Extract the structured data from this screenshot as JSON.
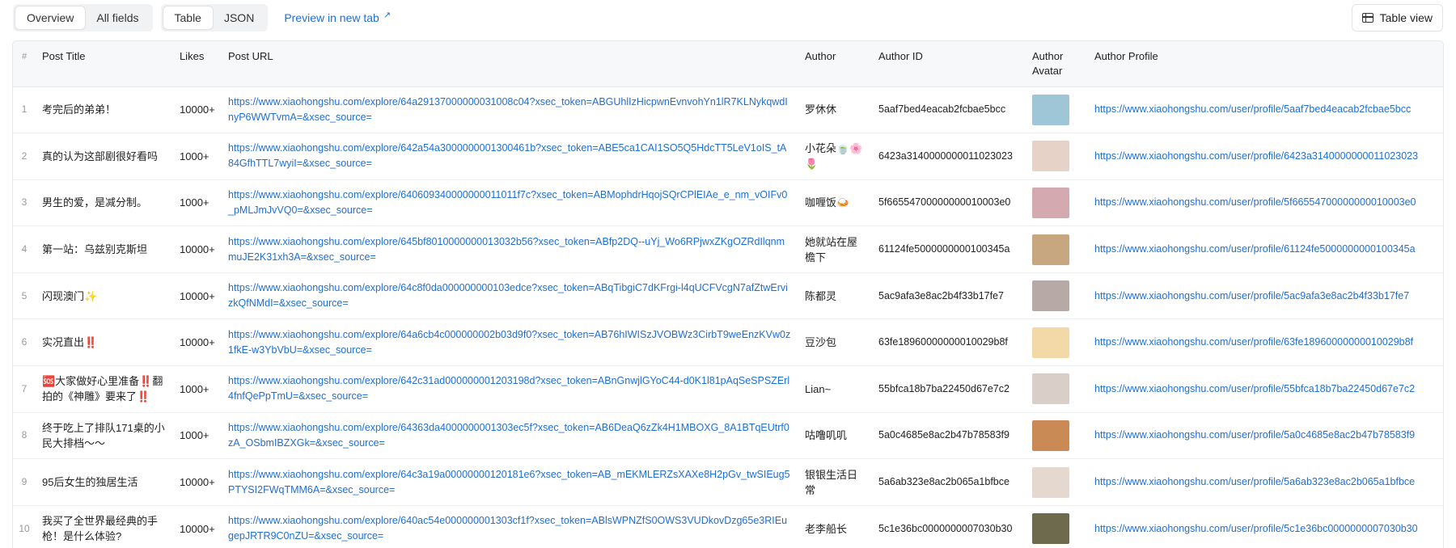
{
  "toolbar": {
    "view_tabs": [
      "Overview",
      "All fields"
    ],
    "format_tabs": [
      "Table",
      "JSON"
    ],
    "preview_link": "Preview in new tab",
    "table_view_button": "Table view"
  },
  "table": {
    "columns": [
      "#",
      "Post Title",
      "Likes",
      "Post URL",
      "Author",
      "Author ID",
      "Author Avatar",
      "Author Profile"
    ],
    "rows": [
      {
        "num": "1",
        "title": "考完后的弟弟！",
        "likes": "10000+",
        "url": "https://www.xiaohongshu.com/explore/64a29137000000031008c04?xsec_token=ABGUhlIzHicpwnEvnvohYn1lR7KLNykqwdInyP6WWTvmA=&xsec_source=",
        "author": "罗休休",
        "author_id": "5aaf7bed4eacab2fcbae5bcc",
        "avatar_color": "#9fc6d6",
        "profile": "https://www.xiaohongshu.com/user/profile/5aaf7bed4eacab2fcbae5bcc"
      },
      {
        "num": "2",
        "title": "真的认为这部剧很好看吗",
        "likes": "1000+",
        "url": "https://www.xiaohongshu.com/explore/642a54a3000000001300461b?xsec_token=ABE5ca1CAI1SO5Q5HdcTT5LeV1oIS_tA84GfhTTL7wyiI=&xsec_source=",
        "author": "小花朵🍵🌸🌷",
        "author_id": "6423a3140000000011023023",
        "avatar_color": "#e6d2c6",
        "profile": "https://www.xiaohongshu.com/user/profile/6423a3140000000011023023"
      },
      {
        "num": "3",
        "title": "男生的爱，是减分制。",
        "likes": "1000+",
        "url": "https://www.xiaohongshu.com/explore/640609340000000011011f7c?xsec_token=ABMophdrHqojSQrCPlEIAe_e_nm_vOIFv0_pMLJmJvVQ0=&xsec_source=",
        "author": "咖喱饭🍛",
        "author_id": "5f66554700000000010003e0",
        "avatar_color": "#d4a9b0",
        "profile": "https://www.xiaohongshu.com/user/profile/5f66554700000000010003e0"
      },
      {
        "num": "4",
        "title": "第一站：乌兹别克斯坦",
        "likes": "10000+",
        "url": "https://www.xiaohongshu.com/explore/645bf8010000000013032b56?xsec_token=ABfp2DQ--uYj_Wo6RPjwxZKgOZRdIlqnmmuJE2K31xh3A=&xsec_source=",
        "author": "她就站在屋檐下",
        "author_id": "61124fe5000000000100345a",
        "avatar_color": "#c6a77f",
        "profile": "https://www.xiaohongshu.com/user/profile/61124fe5000000000100345a"
      },
      {
        "num": "5",
        "title": "闪现澳门✨",
        "likes": "10000+",
        "url": "https://www.xiaohongshu.com/explore/64c8f0da000000000103edce?xsec_token=ABqTibgiC7dKFrgi-l4qUCFVcgN7afZtwErvizkQfNMdI=&xsec_source=",
        "author": "陈都灵",
        "author_id": "5ac9afa3e8ac2b4f33b17fe7",
        "avatar_color": "#b7a9a6",
        "profile": "https://www.xiaohongshu.com/user/profile/5ac9afa3e8ac2b4f33b17fe7"
      },
      {
        "num": "6",
        "title": "实况直出‼️",
        "likes": "10000+",
        "url": "https://www.xiaohongshu.com/explore/64a6cb4c000000002b03d9f0?xsec_token=AB76hIWISzJVOBWz3CirbT9weEnzKVw0z1fkE-w3YbVbU=&xsec_source=",
        "author": "豆沙包",
        "author_id": "63fe18960000000010029b8f",
        "avatar_color": "#f3d9a8",
        "profile": "https://www.xiaohongshu.com/user/profile/63fe18960000000010029b8f"
      },
      {
        "num": "7",
        "title": "🆘大家做好心里准备‼️翻拍的《神雕》要来了‼️",
        "likes": "1000+",
        "url": "https://www.xiaohongshu.com/explore/642c31ad000000001203198d?xsec_token=ABnGnwjlGYoC44-d0K1l81pAqSeSPSZErl4fnfQePpTmU=&xsec_source=",
        "author": "Lian~",
        "author_id": "55bfca18b7ba22450d67e7c2",
        "avatar_color": "#d9cfc8",
        "profile": "https://www.xiaohongshu.com/user/profile/55bfca18b7ba22450d67e7c2"
      },
      {
        "num": "8",
        "title": "终于吃上了排队171桌的小民大排档～～",
        "likes": "1000+",
        "url": "https://www.xiaohongshu.com/explore/64363da4000000001303ec5f?xsec_token=AB6DeaQ6zZk4H1MBOXG_8A1BTqEUtrf0zA_OSbmIBZXGk=&xsec_source=",
        "author": "咕噜叽叽",
        "author_id": "5a0c4685e8ac2b47b78583f9",
        "avatar_color": "#c98a55",
        "profile": "https://www.xiaohongshu.com/user/profile/5a0c4685e8ac2b47b78583f9"
      },
      {
        "num": "9",
        "title": "95后女生的独居生活",
        "likes": "10000+",
        "url": "https://www.xiaohongshu.com/explore/64c3a19a00000000120181e6?xsec_token=AB_mEKMLERZsXAXe8H2pGv_twSIEug5PTYSI2FWqTMM6A=&xsec_source=",
        "author": "银银生活日常",
        "author_id": "5a6ab323e8ac2b065a1bfbce",
        "avatar_color": "#e4d8cf",
        "profile": "https://www.xiaohongshu.com/user/profile/5a6ab323e8ac2b065a1bfbce"
      },
      {
        "num": "10",
        "title": "我买了全世界最经典的手枪！是什么体验?",
        "likes": "10000+",
        "url": "https://www.xiaohongshu.com/explore/640ac54e000000001303cf1f?xsec_token=ABlsWPNZfS0OWS3VUDkovDzg65e3RIEugepJRTR9C0nZU=&xsec_source=",
        "author": "老李船长",
        "author_id": "5c1e36bc0000000007030b30",
        "avatar_color": "#6d6a4e",
        "profile": "https://www.xiaohongshu.com/user/profile/5c1e36bc0000000007030b30"
      }
    ]
  }
}
